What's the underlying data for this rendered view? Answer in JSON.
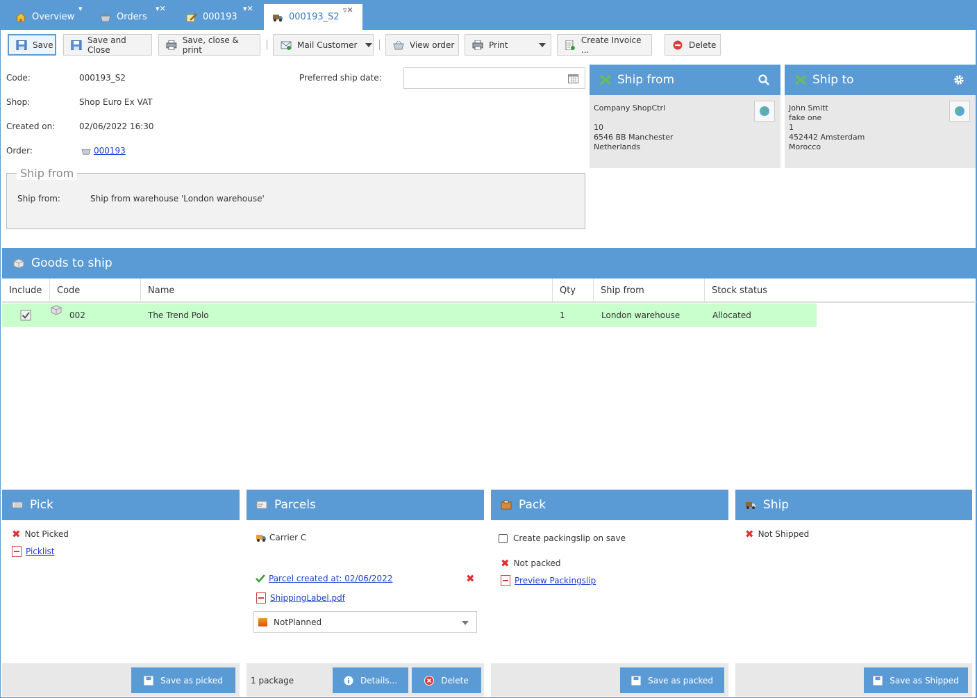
{
  "tabs": [
    {
      "label": "Overview",
      "icon": "home-icon"
    },
    {
      "label": "Orders",
      "icon": "basket-icon"
    },
    {
      "label": "000193",
      "icon": "edit-icon"
    },
    {
      "label": "000193_S2",
      "icon": "truck-icon"
    }
  ],
  "toolbar": {
    "save": "Save",
    "save_close": "Save and Close",
    "save_close_print": "Save, close & print",
    "mail_customer": "Mail Customer",
    "view_order": "View order",
    "print": "Print",
    "create_invoice": "Create Invoice ...",
    "delete": "Delete"
  },
  "form": {
    "code_label": "Code:",
    "code_value": "000193_S2",
    "shop_label": "Shop:",
    "shop_value": "Shop Euro Ex VAT",
    "created_label": "Created on:",
    "created_value": "02/06/2022 16:30",
    "order_label": "Order:",
    "order_value": "000193",
    "pref_ship_label": "Preferred ship date:",
    "pref_ship_value": "",
    "shipfrom_legend": "Ship from",
    "shipfrom_label": "Ship from:",
    "shipfrom_value": "Ship from warehouse 'London warehouse'"
  },
  "ship_from": {
    "title": "Ship from",
    "lines": [
      "Company ShopCtrl",
      "",
      "10",
      "6546 BB Manchester",
      "Netherlands"
    ]
  },
  "ship_to": {
    "title": "Ship to",
    "lines": [
      "John Smitt",
      "fake one",
      "1",
      "452442 Amsterdam",
      "Morocco"
    ]
  },
  "goods": {
    "title": "Goods to ship",
    "columns": [
      "Include",
      "Code",
      "Name",
      "Qty",
      "Ship from",
      "Stock status"
    ],
    "rows": [
      {
        "include": true,
        "code": "002",
        "name": "The Trend Polo",
        "qty": "1",
        "ship_from": "London warehouse",
        "stock_status": "Allocated"
      }
    ]
  },
  "pick": {
    "title": "Pick",
    "status": "Not Picked",
    "picklist": "Picklist",
    "save_btn": "Save as picked"
  },
  "parcels": {
    "title": "Parcels",
    "carrier": "Carrier C",
    "parcel_created": "Parcel created at: 02/06/2022",
    "label_file": "ShippingLabel.pdf",
    "status_select": "NotPlanned",
    "package_count": "1 package",
    "details_btn": "Details...",
    "delete_btn": "Delete"
  },
  "pack": {
    "title": "Pack",
    "checkbox_label": "Create packingslip on save",
    "status": "Not packed",
    "preview": "Preview Packingslip",
    "save_btn": "Save as packed"
  },
  "ship": {
    "title": "Ship",
    "status": "Not Shipped",
    "save_btn": "Save as Shipped"
  },
  "colors": {
    "accent": "#5b9bd5",
    "row_highlight": "#c8ffcc",
    "error": "#e03030",
    "success": "#3a9a3a"
  }
}
